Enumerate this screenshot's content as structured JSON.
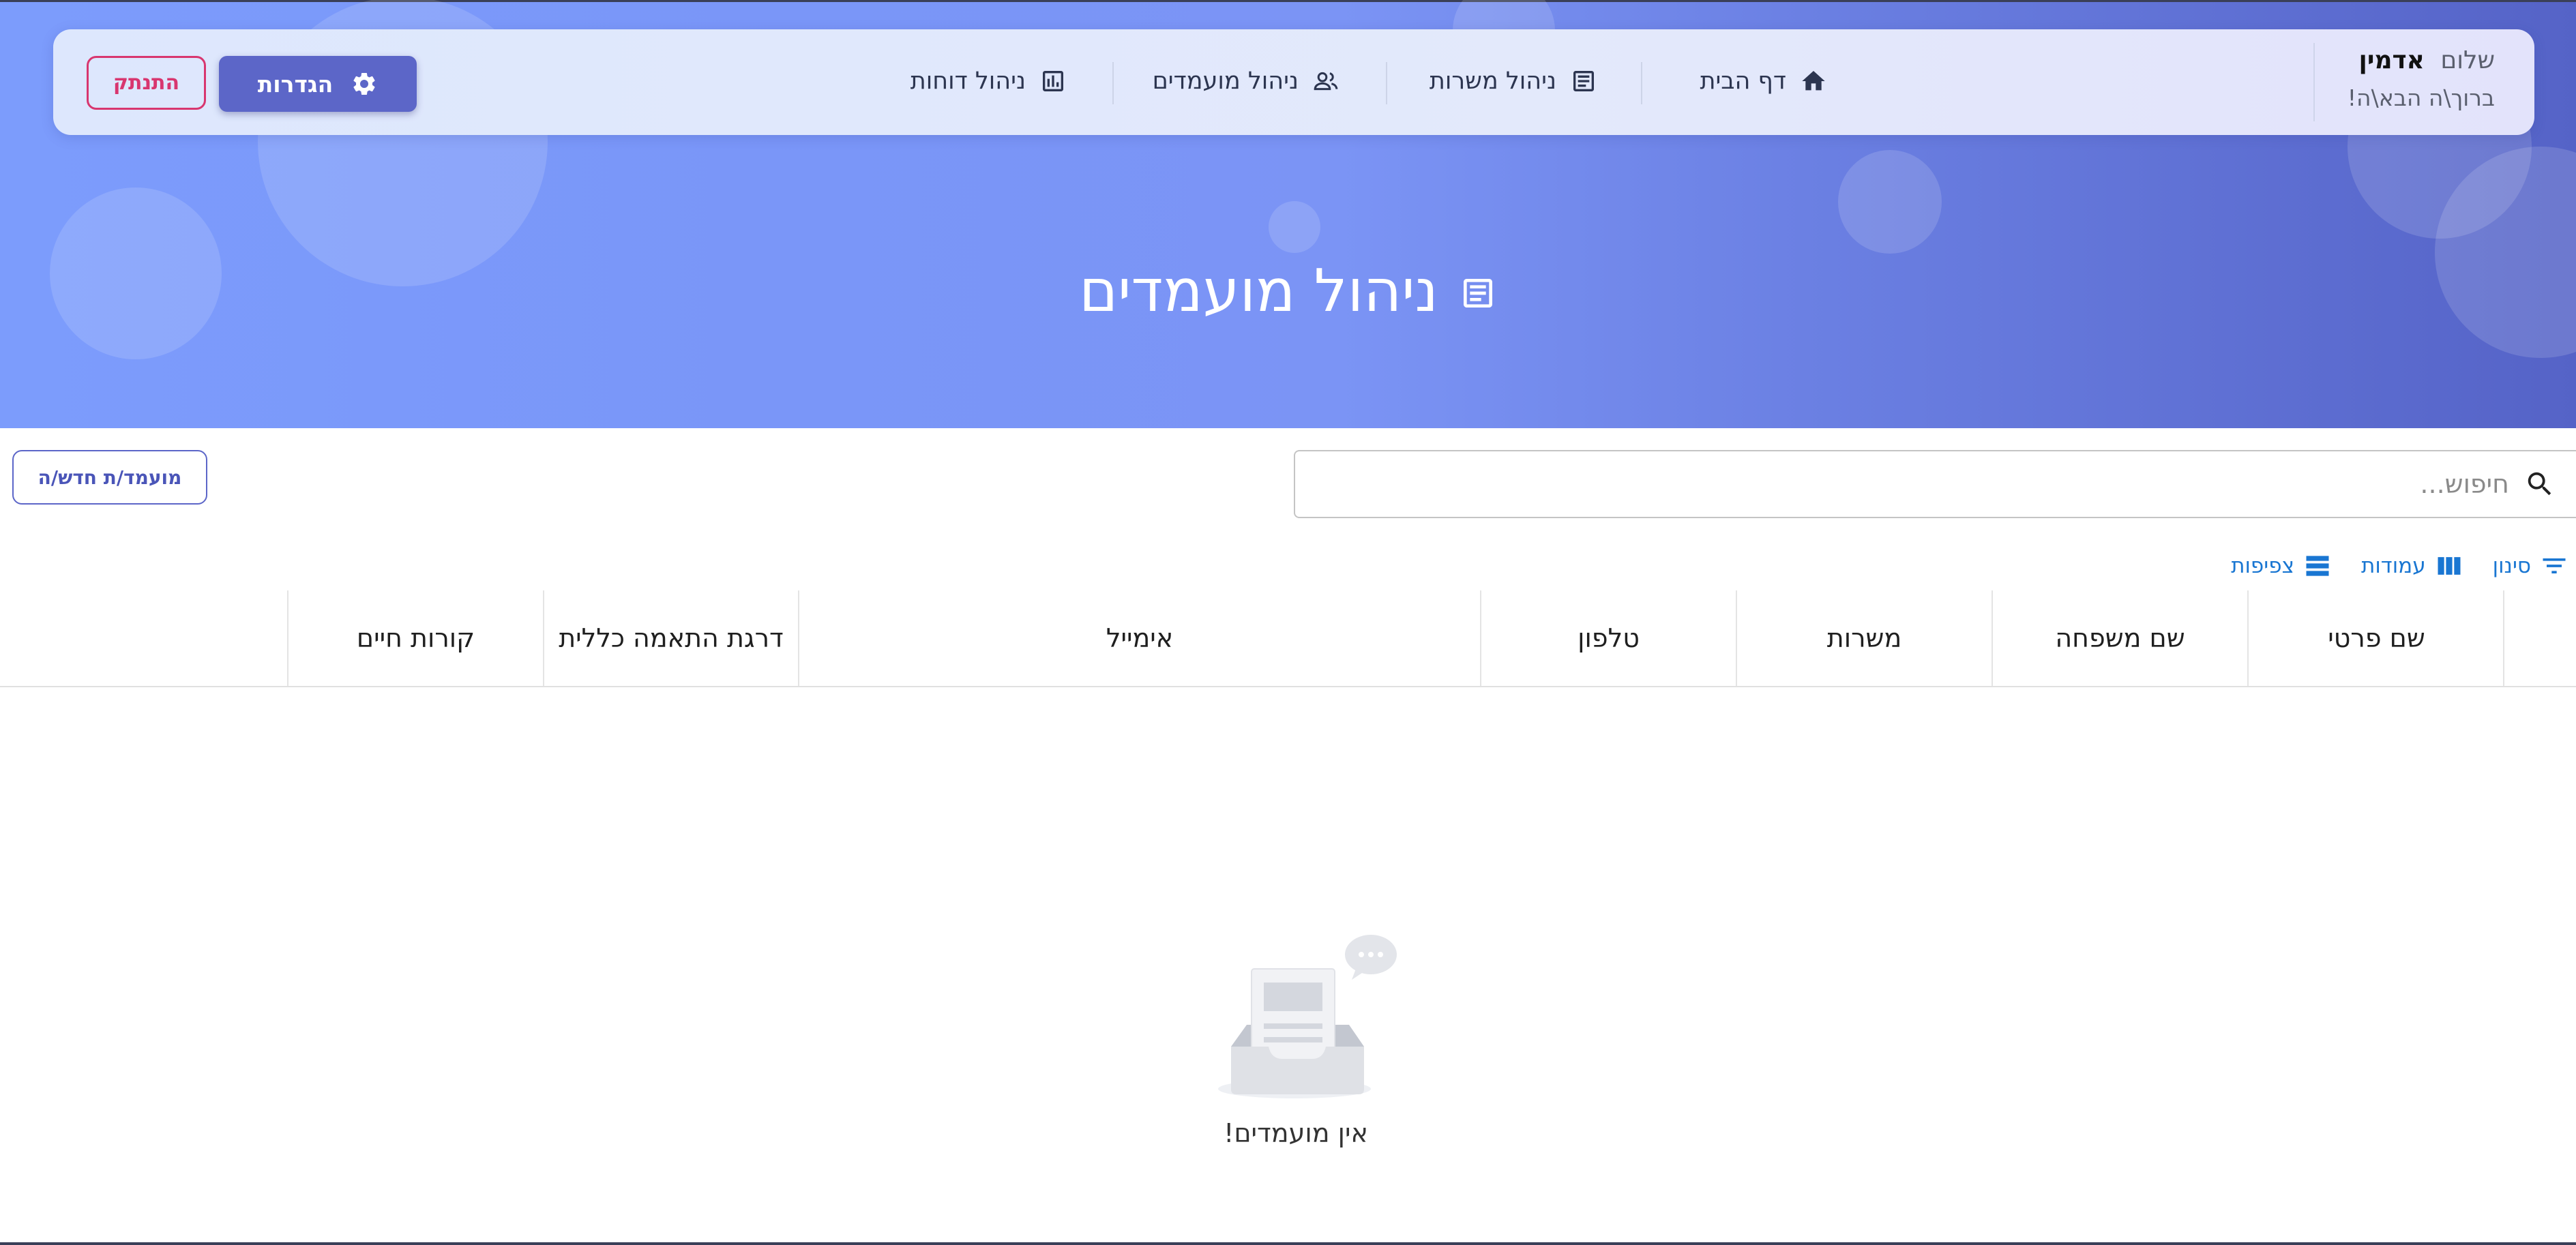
{
  "header": {
    "greeting": "שלום",
    "user_name": "אדמין",
    "welcome": "ברוך\\ה הבא\\ה!"
  },
  "nav": {
    "items": [
      {
        "label": "דף הבית",
        "icon": "home-icon"
      },
      {
        "label": "ניהול משרות",
        "icon": "document-icon"
      },
      {
        "label": "ניהול מועמדים",
        "icon": "people-icon"
      },
      {
        "label": "ניהול דוחות",
        "icon": "bar-chart-icon"
      }
    ],
    "settings_label": "הגדרות",
    "logout_label": "התנתק"
  },
  "page": {
    "title": "ניהול מועמדים",
    "title_icon": "document-icon"
  },
  "toolbar": {
    "search_placeholder": "חיפוש...",
    "new_button_label": "מועמד/ת חדש/ה"
  },
  "grid_tools": {
    "filter_label": "סינון",
    "columns_label": "עמודות",
    "density_label": "צפיפות"
  },
  "table": {
    "columns": [
      "שם פרטי",
      "שם משפחה",
      "משרות",
      "טלפון",
      "אימייל",
      "דרגת התאמה כללית",
      "קורות חיים"
    ],
    "rows": []
  },
  "empty_state": {
    "message": "אין מועמדים!",
    "icon": "empty-inbox-icon"
  },
  "colors": {
    "hero_gradient_start": "#7c9cfc",
    "hero_gradient_end": "#5563c7",
    "primary_button": "#5c66c8",
    "logout": "#d8366f",
    "grid_tool": "#1976d2"
  }
}
